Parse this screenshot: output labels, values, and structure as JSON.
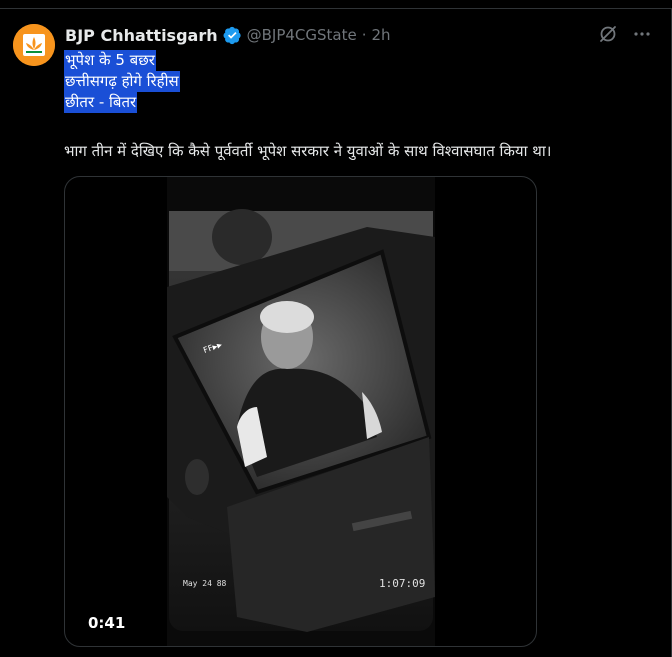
{
  "tweet": {
    "author_name": "BJP Chhattisgarh",
    "author_handle": "@BJP4CGState",
    "separator": "·",
    "time": "2h",
    "verified": true,
    "highlighted_lines": [
      "भूपेश के 5 बछर",
      "छत्तीसगढ़ होगे रिहीस",
      "छीतर - बितर"
    ],
    "body": "भाग तीन में देखिए कि कैसे पूर्ववर्ती भूपेश सरकार ने युवाओं के साथ विश्वासघात किया था।"
  },
  "media": {
    "duration": "0:41",
    "overlay_ff": "FF▶▶",
    "overlay_date": "May 24 88",
    "overlay_timecode": "1:07:09"
  },
  "icons": {
    "avatar": "bjp-lotus-logo",
    "verified": "verified-badge-icon",
    "grok": "grok-icon",
    "more": "more-icon"
  },
  "colors": {
    "background": "#000000",
    "text": "#e7e9ea",
    "muted": "#71767b",
    "highlight": "#1a4fd6",
    "verified": "#1d9bf0",
    "avatar_bg": "#f7941d"
  }
}
